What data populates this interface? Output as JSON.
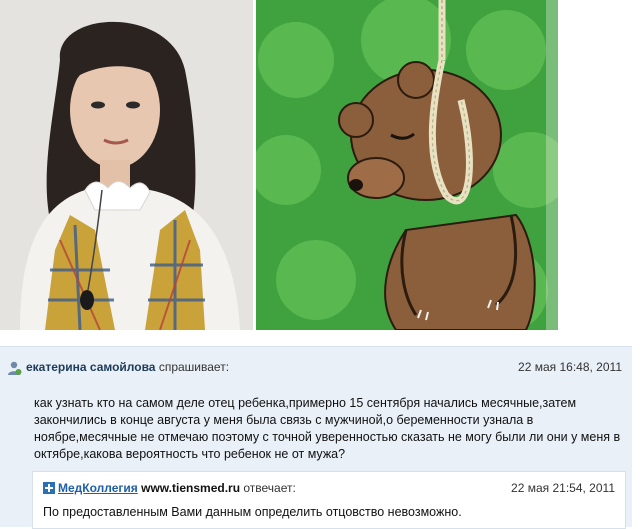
{
  "question": {
    "author": "екатерина самойлова",
    "action": "спрашивает:",
    "date": "22 мая 16:48, 2011",
    "text": "как узнать кто на самом деле отец ребенка,примерно 15 сентября начались месячные,затем закончились в конце августа у меня была связь с мужчиной,о беременности узнала в ноябре,месячные не отмечаю поэтому с точной уверенностью сказать не могу были ли они у меня в октябре,какова вероятность что ребенок не от мужа?"
  },
  "answer": {
    "source": "МедКоллегия",
    "site": "www.tiensmed.ru",
    "action": "отвечает:",
    "date": "22 мая 21:54, 2011",
    "text": "По предоставленным Вами данным определить отцовство невозможно."
  },
  "colors": {
    "panel_bg": "#e9f0f7",
    "link": "#1f5fa8",
    "bush_green": "#3fa23f",
    "bear_brown": "#8b5e3c"
  }
}
